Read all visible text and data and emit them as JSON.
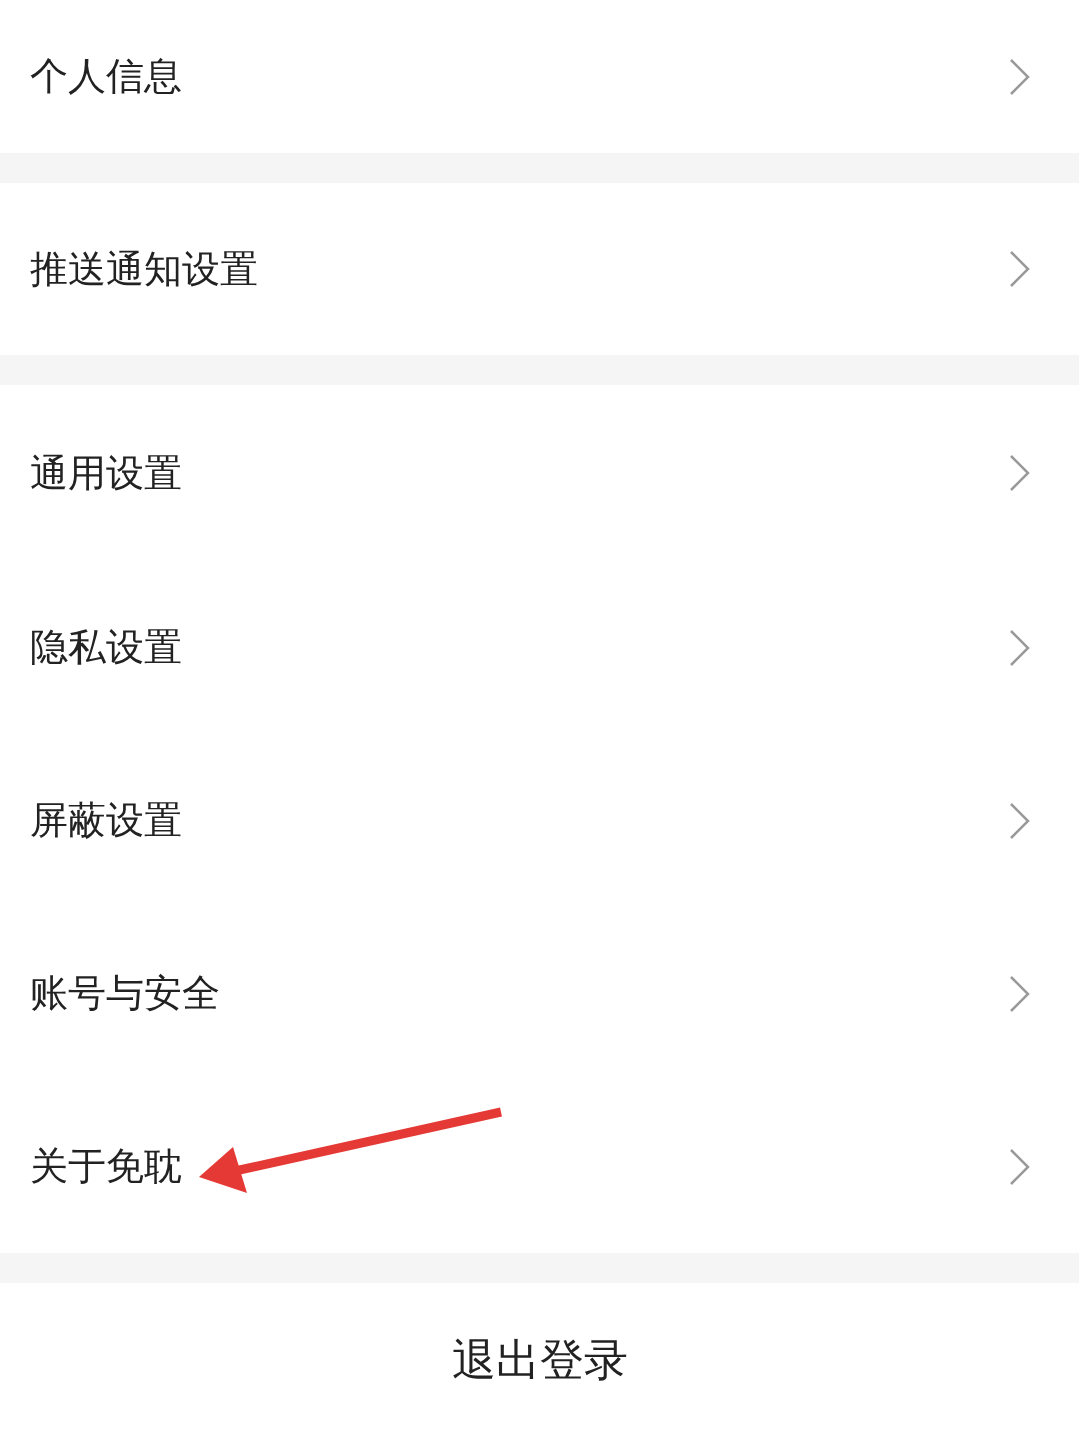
{
  "sections": [
    {
      "items": [
        {
          "label": "个人信息"
        }
      ]
    },
    {
      "items": [
        {
          "label": "推送通知设置"
        }
      ]
    },
    {
      "items": [
        {
          "label": "通用设置"
        },
        {
          "label": "隐私设置"
        },
        {
          "label": "屏蔽设置"
        },
        {
          "label": "账号与安全"
        },
        {
          "label": "关于免耽"
        }
      ]
    }
  ],
  "logout_button": "退出登录"
}
